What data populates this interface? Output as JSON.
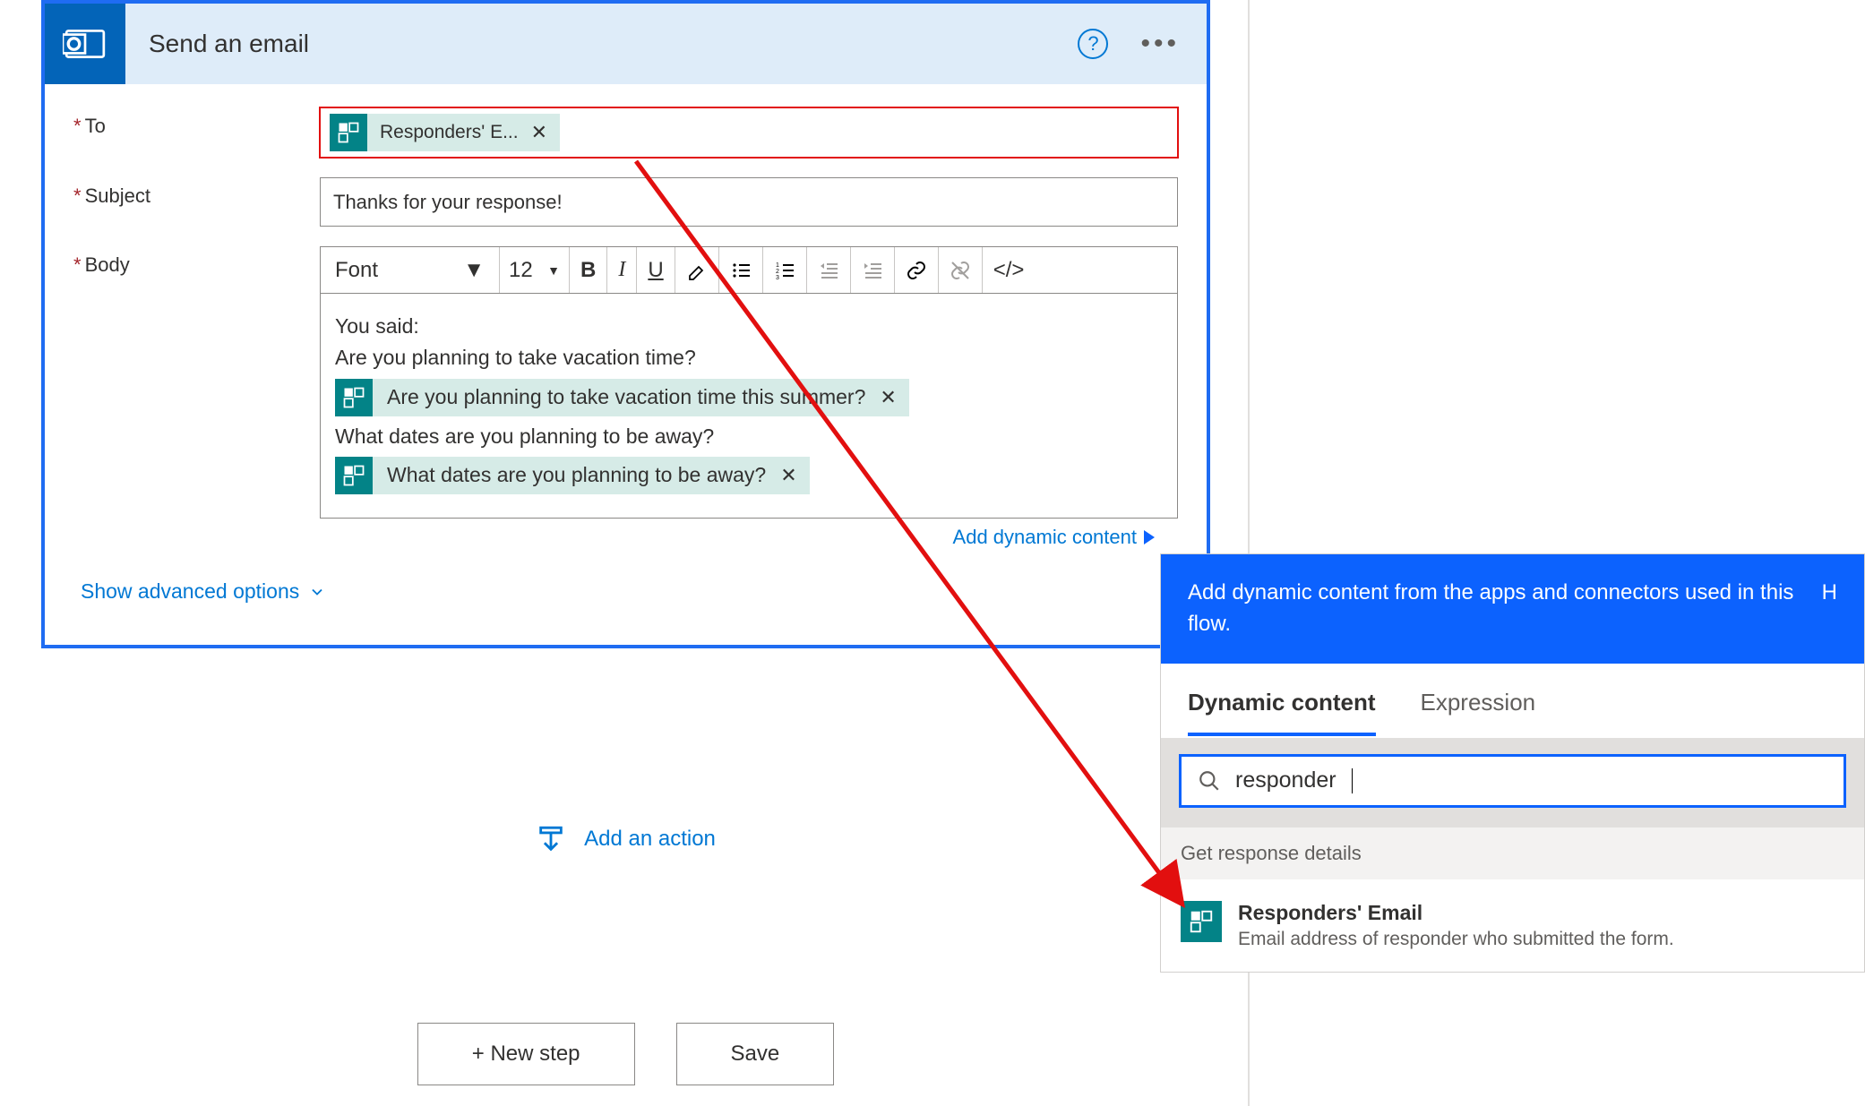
{
  "card": {
    "title": "Send an email",
    "help_aria": "Help",
    "more_aria": "More"
  },
  "fields": {
    "to_label": "To",
    "to_token": "Responders' E...",
    "subject_label": "Subject",
    "subject_value": "Thanks for your response!",
    "body_label": "Body"
  },
  "toolbar": {
    "font": "Font",
    "size": "12"
  },
  "body": {
    "line1": "You said:",
    "q1": "Are you planning to take vacation time?",
    "token1": "Are you planning to take vacation time this summer?",
    "q2": "What dates are you planning to be away?",
    "token2": "What dates are you planning to be away?"
  },
  "links": {
    "add_dynamic": "Add dynamic content",
    "advanced": "Show advanced options",
    "add_action": "Add an action"
  },
  "buttons": {
    "new_step": "+ New step",
    "save": "Save"
  },
  "dc": {
    "banner": "Add dynamic content from the apps and connectors used in this flow.",
    "hide": "H",
    "tab_dynamic": "Dynamic content",
    "tab_expression": "Expression",
    "search_value": "responder",
    "group": "Get response details",
    "item_title": "Responders' Email",
    "item_desc": "Email address of responder who submitted the form."
  }
}
